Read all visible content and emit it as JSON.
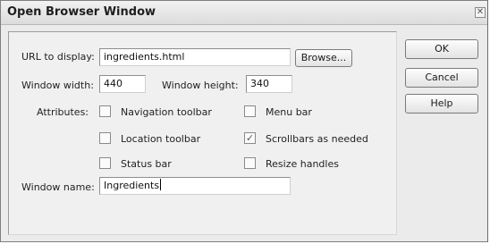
{
  "dialog": {
    "title": "Open Browser Window",
    "close_glyph": "✕"
  },
  "form": {
    "url_label": "URL to display:",
    "url_value": "ingredients.html",
    "browse_label": "Browse...",
    "width_label": "Window width:",
    "width_value": "440",
    "height_label": "Window height:",
    "height_value": "340",
    "attributes_label": "Attributes:",
    "attributes": [
      {
        "label": "Navigation toolbar",
        "checked": false
      },
      {
        "label": "Menu bar",
        "checked": false
      },
      {
        "label": "Location toolbar",
        "checked": false
      },
      {
        "label": "Scrollbars as needed",
        "checked": true
      },
      {
        "label": "Status bar",
        "checked": false
      },
      {
        "label": "Resize handles",
        "checked": false
      }
    ],
    "name_label": "Window name:",
    "name_value": "Ingredients"
  },
  "buttons": {
    "ok": "OK",
    "cancel": "Cancel",
    "help": "Help"
  },
  "icons": {
    "check_glyph": "✓"
  }
}
